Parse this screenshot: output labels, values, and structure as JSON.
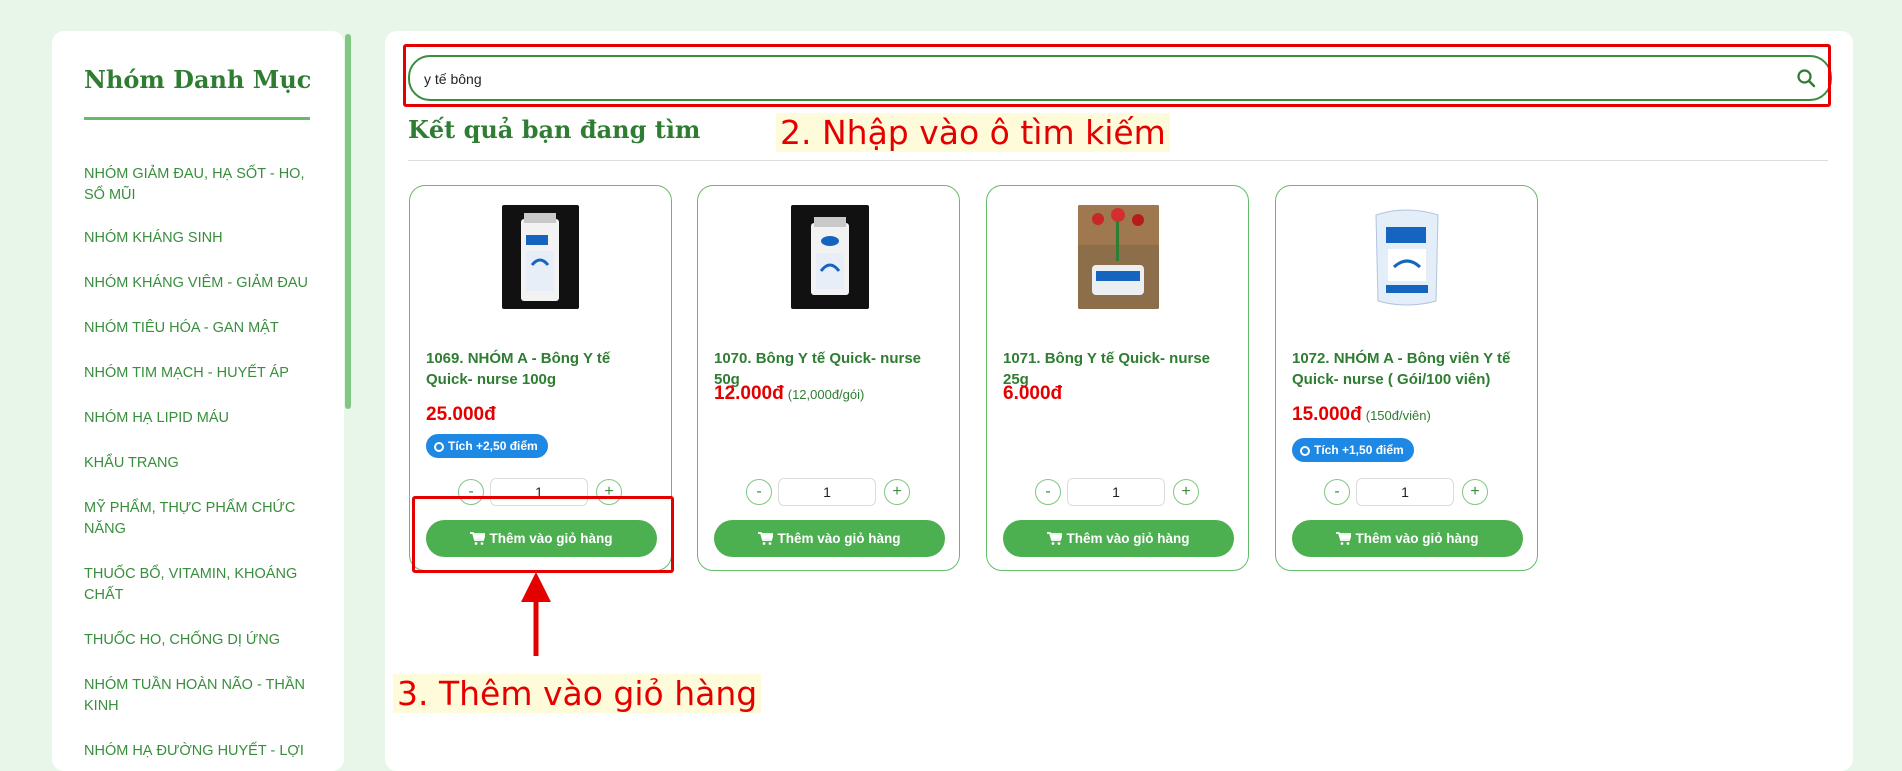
{
  "sidebar": {
    "title": "Nhóm Danh Mục",
    "items": [
      {
        "label": "NHÓM GIẢM ĐAU, HẠ SỐT - HO, SỔ MŨI"
      },
      {
        "label": "NHÓM KHÁNG SINH"
      },
      {
        "label": "NHÓM KHÁNG VIÊM - GIẢM ĐAU"
      },
      {
        "label": "NHÓM TIÊU HÓA - GAN MẬT"
      },
      {
        "label": "NHÓM TIM MẠCH - HUYẾT ÁP"
      },
      {
        "label": "NHÓM HẠ LIPID MÁU"
      },
      {
        "label": "KHẨU TRANG"
      },
      {
        "label": "MỸ PHẨM, THỰC PHẨM CHỨC NĂNG"
      },
      {
        "label": "THUỐC BỔ, VITAMIN, KHOÁNG CHẤT"
      },
      {
        "label": "THUỐC HO, CHỐNG DỊ ỨNG"
      },
      {
        "label": "NHÓM TUẦN HOÀN NÃO - THẦN KINH"
      },
      {
        "label": "NHÓM HẠ ĐƯỜNG HUYẾT - LỢI"
      }
    ]
  },
  "search": {
    "value": "y tế bông",
    "icon": "search-icon"
  },
  "results": {
    "title": "Kết quả bạn đang tìm"
  },
  "annotations": {
    "step2": "2. Nhập vào ô tìm kiếm",
    "step3": "3. Thêm vào giỏ hàng",
    "color": "#e50000"
  },
  "products": [
    {
      "name": "1069. NHÓM A - Bông Y tế Quick- nurse 100g",
      "price": "25.000đ",
      "unit": "",
      "badge": "Tích +2,50 điểm",
      "qty": "1",
      "add_label": "Thêm vào giỏ hàng"
    },
    {
      "name": "1070. Bông Y tế Quick- nurse 50g",
      "price": "12.000đ",
      "unit": "(12,000đ/gói)",
      "badge": "",
      "qty": "1",
      "add_label": "Thêm vào giỏ hàng"
    },
    {
      "name": "1071. Bông Y tế Quick- nurse 25g",
      "price": "6.000đ",
      "unit": "",
      "badge": "",
      "qty": "1",
      "add_label": "Thêm vào giỏ hàng"
    },
    {
      "name": "1072. NHÓM A - Bông viên Y tế Quick- nurse ( Gói/100 viên)",
      "price": "15.000đ",
      "unit": "(150đ/viên)",
      "badge": "Tích +1,50 điểm",
      "qty": "1",
      "add_label": "Thêm vào giỏ hàng"
    }
  ],
  "qty_controls": {
    "minus": "-",
    "plus": "+"
  },
  "colors": {
    "brand": "#2e7d32",
    "button": "#4caf50",
    "price": "#e50000",
    "badge": "#1e88e5"
  }
}
